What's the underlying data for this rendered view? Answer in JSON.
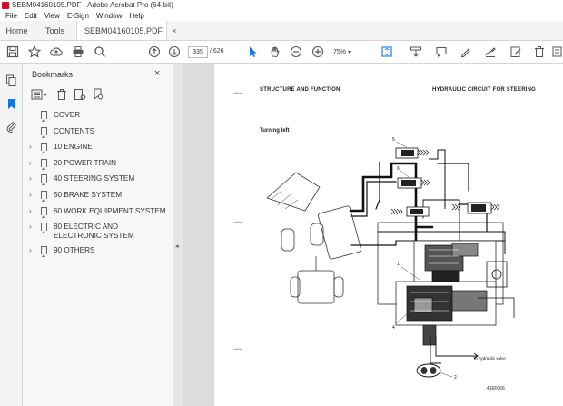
{
  "window": {
    "title": "SEBM04160105.PDF - Adobe Acrobat Pro (64-bit)"
  },
  "menu": [
    "File",
    "Edit",
    "View",
    "E-Sign",
    "Window",
    "Help"
  ],
  "tabs": {
    "home": "Home",
    "tools": "Tools",
    "document": "SEBM04160105.PDF",
    "close": "×"
  },
  "toolbar": {
    "current_page": "335",
    "total_pages": "/ 626",
    "zoom": "75%"
  },
  "bookmarks_panel": {
    "title": "Bookmarks",
    "close": "×",
    "items": [
      {
        "label": "COVER",
        "expandable": false
      },
      {
        "label": "CONTENTS",
        "expandable": false
      },
      {
        "label": "10 ENGINE",
        "expandable": true
      },
      {
        "label": "20 POWER TRAIN",
        "expandable": true
      },
      {
        "label": "40 STEERING SYSTEM",
        "expandable": true
      },
      {
        "label": "50 BRAKE SYSTEM",
        "expandable": true
      },
      {
        "label": "60 WORK EQUIPMENT SYSTEM",
        "expandable": true
      },
      {
        "label": "80 ELECTRIC AND ELECTRONIC SYSTEM",
        "expandable": true
      },
      {
        "label": "90 OTHERS",
        "expandable": true
      }
    ]
  },
  "document_page": {
    "header_left": "STRUCTURE AND FUNCTION",
    "header_right": "HYDRAULIC CIRCUIT FOR STEERING",
    "subtitle": "Turning left",
    "figure_code": "416F066",
    "annotation": "To hydraulic valve",
    "callouts": [
      "5",
      "6",
      "1",
      "2",
      "4"
    ]
  },
  "colors": {
    "accent": "#1473e6",
    "toolbar_bg": "#f4f4f4",
    "viewer_bg": "#dcdcdc"
  }
}
